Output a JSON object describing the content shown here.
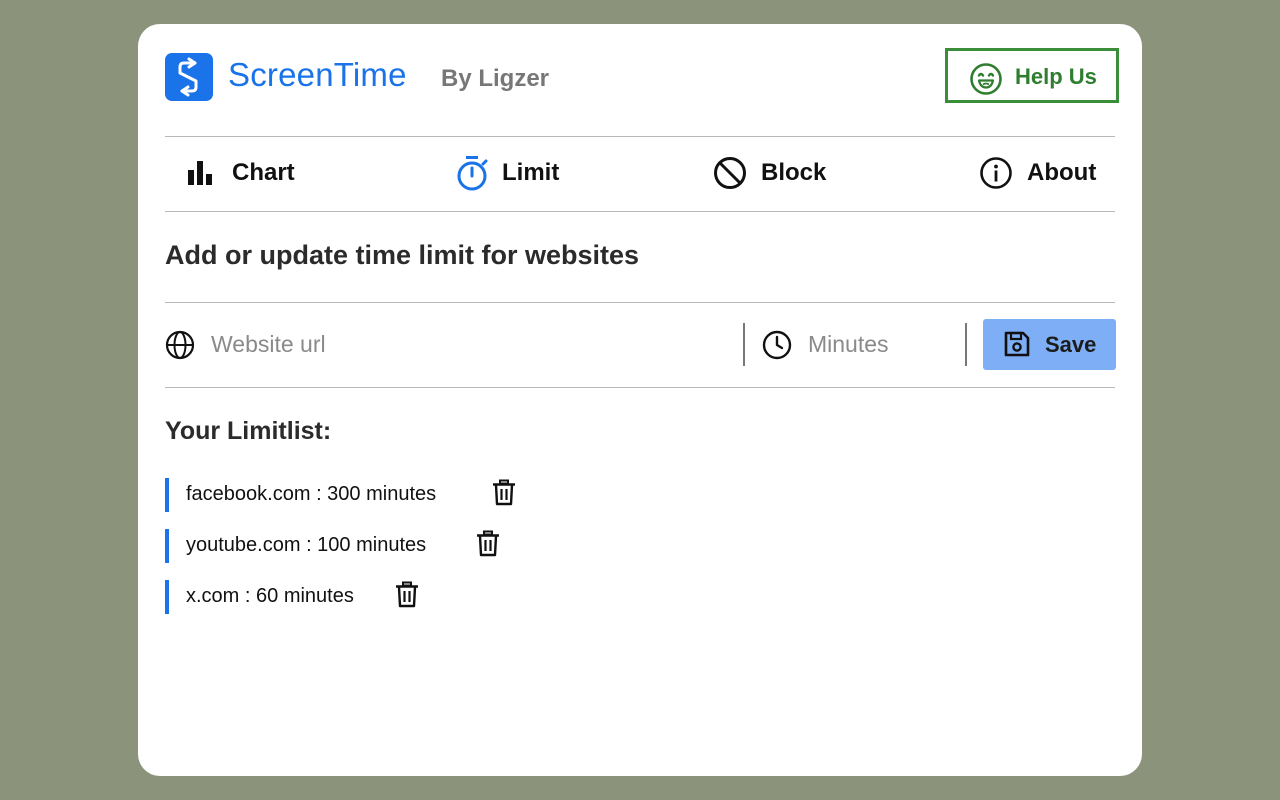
{
  "header": {
    "brand": "ScreenTime",
    "byline": "By Ligzer",
    "help_label": "Help Us"
  },
  "tabs": [
    {
      "label": "Chart",
      "icon": "bar-chart-icon",
      "active": false
    },
    {
      "label": "Limit",
      "icon": "stopwatch-icon",
      "active": true
    },
    {
      "label": "Block",
      "icon": "block-icon",
      "active": false
    },
    {
      "label": "About",
      "icon": "info-icon",
      "active": false
    }
  ],
  "section_title": "Add or update time limit for websites",
  "form": {
    "url_placeholder": "Website url",
    "minutes_placeholder": "Minutes",
    "save_label": "Save"
  },
  "list": {
    "title": "Your Limitlist:",
    "items": [
      {
        "text": "facebook.com : 300 minutes"
      },
      {
        "text": "youtube.com : 100 minutes"
      },
      {
        "text": "x.com : 60 minutes"
      }
    ]
  },
  "colors": {
    "accent": "#1a73e8",
    "help_green": "#3a8e3a",
    "save_bg": "#7eaef5",
    "page_bg": "#8b937b"
  }
}
